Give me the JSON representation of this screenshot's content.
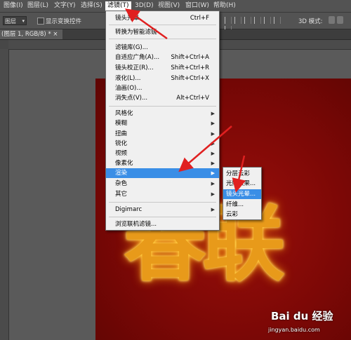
{
  "menubar": {
    "items": [
      {
        "label": "图像(I)"
      },
      {
        "label": "图层(L)"
      },
      {
        "label": "文字(Y)"
      },
      {
        "label": "选择(S)"
      },
      {
        "label": "滤镜(T)"
      },
      {
        "label": "3D(D)"
      },
      {
        "label": "视图(V)"
      },
      {
        "label": "窗口(W)"
      },
      {
        "label": "帮助(H)"
      }
    ]
  },
  "options_bar": {
    "layer_select_value": "图层",
    "show_transform_label": "显示变换控件",
    "mode_3d_label": "3D 模式:"
  },
  "document_tab": {
    "label": "(图层 1, RGB/8) * ×"
  },
  "filter_menu": {
    "items": [
      {
        "label": "镜头光晕",
        "shortcut": "Ctrl+F"
      },
      {
        "label": "转换为智能滤镜",
        "shortcut": ""
      },
      {
        "label": "滤镜库(G)...",
        "shortcut": ""
      },
      {
        "label": "自适应广角(A)...",
        "shortcut": "Shift+Ctrl+A"
      },
      {
        "label": "镜头校正(R)...",
        "shortcut": "Shift+Ctrl+R"
      },
      {
        "label": "液化(L)...",
        "shortcut": "Shift+Ctrl+X"
      },
      {
        "label": "油画(O)...",
        "shortcut": ""
      },
      {
        "label": "消失点(V)...",
        "shortcut": "Alt+Ctrl+V"
      },
      {
        "label": "风格化",
        "shortcut": ""
      },
      {
        "label": "模糊",
        "shortcut": ""
      },
      {
        "label": "扭曲",
        "shortcut": ""
      },
      {
        "label": "锐化",
        "shortcut": ""
      },
      {
        "label": "视频",
        "shortcut": ""
      },
      {
        "label": "像素化",
        "shortcut": ""
      },
      {
        "label": "渲染",
        "shortcut": ""
      },
      {
        "label": "杂色",
        "shortcut": ""
      },
      {
        "label": "其它",
        "shortcut": ""
      },
      {
        "label": "Digimarc",
        "shortcut": ""
      },
      {
        "label": "浏览联机滤镜...",
        "shortcut": ""
      }
    ]
  },
  "render_submenu": {
    "items": [
      {
        "label": "分层云彩"
      },
      {
        "label": "光照效果..."
      },
      {
        "label": "镜头光晕..."
      },
      {
        "label": "纤维..."
      },
      {
        "label": "云彩"
      }
    ]
  },
  "canvas_text": "春联",
  "watermark": {
    "logo": "Bai du 经验",
    "url": "jingyan.baidu.com"
  },
  "colors": {
    "ui_dark": "#535353",
    "menu_bg": "#f0f0f0",
    "highlight": "#3a8ee6",
    "canvas_red": "#7c0806",
    "arrow_red": "#e02020"
  }
}
